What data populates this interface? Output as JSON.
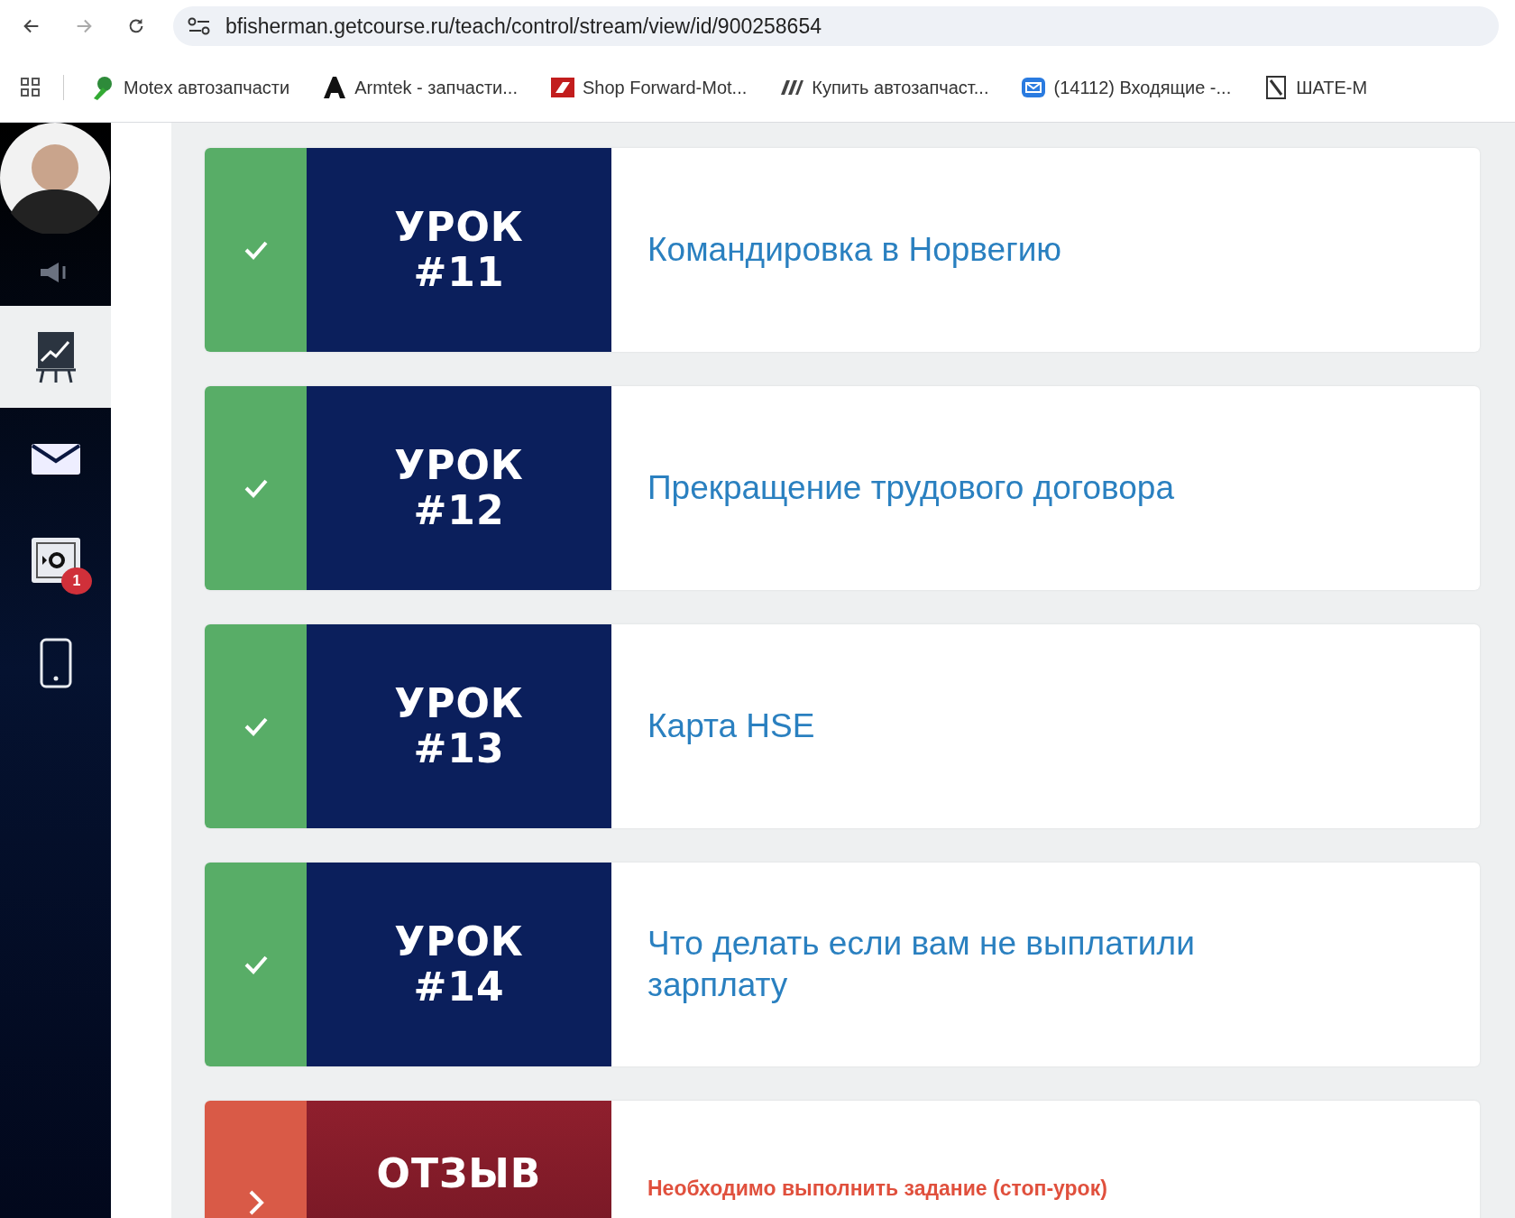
{
  "browser": {
    "url": "bfisherman.getcourse.ru/teach/control/stream/view/id/900258654",
    "bookmarks": [
      {
        "label": "Motex автозапчасти",
        "kind": "motex"
      },
      {
        "label": "Armtek - запчасти...",
        "kind": "armtek"
      },
      {
        "label": "Shop Forward-Mot...",
        "kind": "forward"
      },
      {
        "label": "Купить автозапчаст...",
        "kind": "ml"
      },
      {
        "label": "(14112) Входящие -...",
        "kind": "mail"
      },
      {
        "label": "ШАТЕ-М",
        "kind": "shate"
      }
    ]
  },
  "sidebar": {
    "items": [
      {
        "kind": "chart",
        "selected": true
      },
      {
        "kind": "mail",
        "selected": false
      },
      {
        "kind": "safe",
        "selected": false,
        "badge": "1"
      },
      {
        "kind": "phone",
        "selected": false
      }
    ]
  },
  "lessons": [
    {
      "done": true,
      "label": "УРОК",
      "number": "#11",
      "title": "Командировка в Норвегию"
    },
    {
      "done": true,
      "label": "УРОК",
      "number": "#12",
      "title": "Прекращение трудового договора"
    },
    {
      "done": true,
      "label": "УРОК",
      "number": "#13",
      "title": "Карта HSE"
    },
    {
      "done": true,
      "label": "УРОК",
      "number": "#14",
      "title": "Что делать если вам не выплатили зарплату"
    },
    {
      "done": false,
      "label": "ОТЗЫВ",
      "notice": "Необходимо выполнить задание (стоп-урок)"
    }
  ]
}
